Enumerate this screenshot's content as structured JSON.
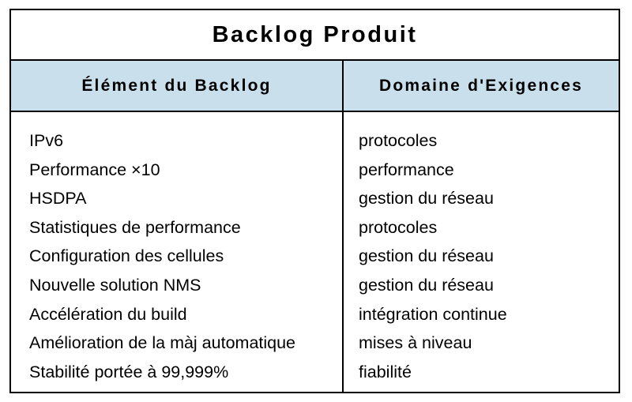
{
  "table": {
    "title": "Backlog Produit",
    "headers": [
      "Élément du Backlog",
      "Domaine d'Exigences"
    ],
    "rows": [
      {
        "item": "IPv6",
        "domain": "protocoles"
      },
      {
        "item": "Performance ×10",
        "domain": "performance"
      },
      {
        "item": "HSDPA",
        "domain": "gestion du réseau"
      },
      {
        "item": "Statistiques de performance",
        "domain": "protocoles"
      },
      {
        "item": "Configuration des cellules",
        "domain": "gestion du réseau"
      },
      {
        "item": "Nouvelle solution NMS",
        "domain": "gestion du réseau"
      },
      {
        "item": "Accélération du build",
        "domain": "intégration continue"
      },
      {
        "item": "Amélioration de la màj automatique",
        "domain": "mises à niveau"
      },
      {
        "item": "Stabilité portée à 99,999%",
        "domain": "fiabilité"
      }
    ]
  },
  "colors": {
    "header_background": "#c9dfec",
    "border": "#000000",
    "text": "#000000"
  }
}
